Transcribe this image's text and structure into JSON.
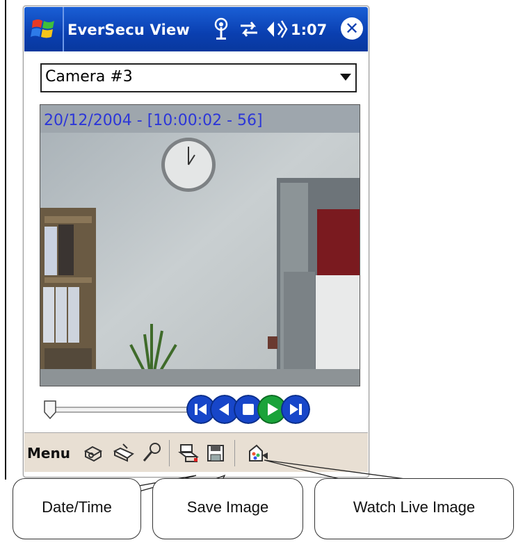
{
  "app": {
    "title": "EverSecu View",
    "clock": "1:07"
  },
  "icons": {
    "start": "windows-flag-icon",
    "signal": "signal-icon",
    "connectivity": "connectivity-arrows-icon",
    "volume": "volume-icon",
    "close": "close-icon"
  },
  "camera_select": {
    "value": "Camera #3"
  },
  "viewer": {
    "timestamp": "20/12/2004 - [10:00:02 - 56]"
  },
  "playback": {
    "position": 0,
    "buttons": [
      "skip-to-start",
      "previous",
      "stop",
      "play",
      "skip-to-end"
    ]
  },
  "menubar": {
    "menu_label": "Menu",
    "icons": [
      "cameras-icon",
      "search-files-icon",
      "settings-wrench-icon",
      "date-time-icon",
      "save-image-icon",
      "watch-live-image-icon"
    ]
  },
  "callouts": {
    "date_time": "Date/Time",
    "save_image": "Save Image",
    "watch_live": "Watch Live Image"
  },
  "colors": {
    "titlebar": "#0a3fb0",
    "timestamp": "#2c36d8",
    "menubar": "#e8dfd3",
    "transport_blue": "#1746c9",
    "transport_green": "#1aa33a"
  }
}
